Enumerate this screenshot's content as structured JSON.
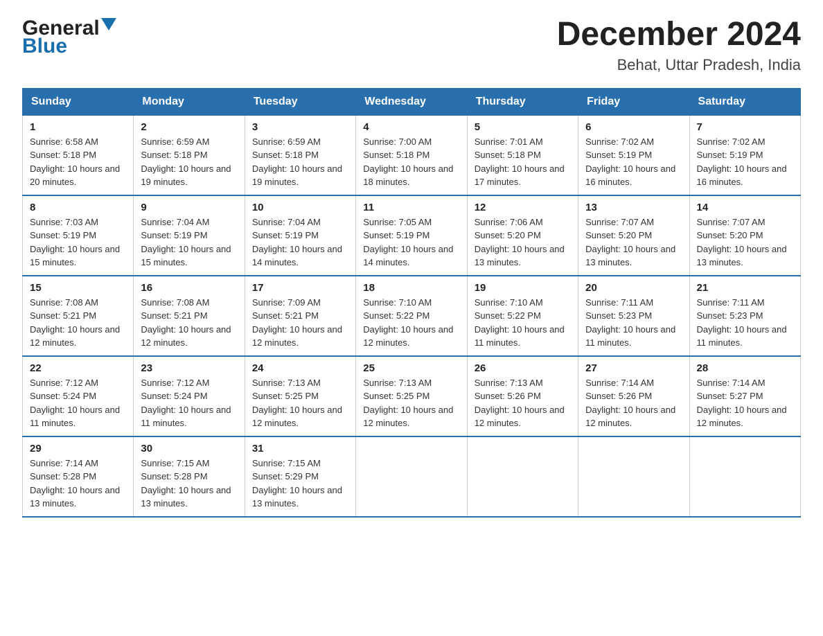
{
  "logo": {
    "general": "General",
    "blue": "Blue"
  },
  "title": "December 2024",
  "subtitle": "Behat, Uttar Pradesh, India",
  "days_of_week": [
    "Sunday",
    "Monday",
    "Tuesday",
    "Wednesday",
    "Thursday",
    "Friday",
    "Saturday"
  ],
  "weeks": [
    [
      {
        "num": "1",
        "sunrise": "6:58 AM",
        "sunset": "5:18 PM",
        "daylight": "10 hours and 20 minutes."
      },
      {
        "num": "2",
        "sunrise": "6:59 AM",
        "sunset": "5:18 PM",
        "daylight": "10 hours and 19 minutes."
      },
      {
        "num": "3",
        "sunrise": "6:59 AM",
        "sunset": "5:18 PM",
        "daylight": "10 hours and 19 minutes."
      },
      {
        "num": "4",
        "sunrise": "7:00 AM",
        "sunset": "5:18 PM",
        "daylight": "10 hours and 18 minutes."
      },
      {
        "num": "5",
        "sunrise": "7:01 AM",
        "sunset": "5:18 PM",
        "daylight": "10 hours and 17 minutes."
      },
      {
        "num": "6",
        "sunrise": "7:02 AM",
        "sunset": "5:19 PM",
        "daylight": "10 hours and 16 minutes."
      },
      {
        "num": "7",
        "sunrise": "7:02 AM",
        "sunset": "5:19 PM",
        "daylight": "10 hours and 16 minutes."
      }
    ],
    [
      {
        "num": "8",
        "sunrise": "7:03 AM",
        "sunset": "5:19 PM",
        "daylight": "10 hours and 15 minutes."
      },
      {
        "num": "9",
        "sunrise": "7:04 AM",
        "sunset": "5:19 PM",
        "daylight": "10 hours and 15 minutes."
      },
      {
        "num": "10",
        "sunrise": "7:04 AM",
        "sunset": "5:19 PM",
        "daylight": "10 hours and 14 minutes."
      },
      {
        "num": "11",
        "sunrise": "7:05 AM",
        "sunset": "5:19 PM",
        "daylight": "10 hours and 14 minutes."
      },
      {
        "num": "12",
        "sunrise": "7:06 AM",
        "sunset": "5:20 PM",
        "daylight": "10 hours and 13 minutes."
      },
      {
        "num": "13",
        "sunrise": "7:07 AM",
        "sunset": "5:20 PM",
        "daylight": "10 hours and 13 minutes."
      },
      {
        "num": "14",
        "sunrise": "7:07 AM",
        "sunset": "5:20 PM",
        "daylight": "10 hours and 13 minutes."
      }
    ],
    [
      {
        "num": "15",
        "sunrise": "7:08 AM",
        "sunset": "5:21 PM",
        "daylight": "10 hours and 12 minutes."
      },
      {
        "num": "16",
        "sunrise": "7:08 AM",
        "sunset": "5:21 PM",
        "daylight": "10 hours and 12 minutes."
      },
      {
        "num": "17",
        "sunrise": "7:09 AM",
        "sunset": "5:21 PM",
        "daylight": "10 hours and 12 minutes."
      },
      {
        "num": "18",
        "sunrise": "7:10 AM",
        "sunset": "5:22 PM",
        "daylight": "10 hours and 12 minutes."
      },
      {
        "num": "19",
        "sunrise": "7:10 AM",
        "sunset": "5:22 PM",
        "daylight": "10 hours and 11 minutes."
      },
      {
        "num": "20",
        "sunrise": "7:11 AM",
        "sunset": "5:23 PM",
        "daylight": "10 hours and 11 minutes."
      },
      {
        "num": "21",
        "sunrise": "7:11 AM",
        "sunset": "5:23 PM",
        "daylight": "10 hours and 11 minutes."
      }
    ],
    [
      {
        "num": "22",
        "sunrise": "7:12 AM",
        "sunset": "5:24 PM",
        "daylight": "10 hours and 11 minutes."
      },
      {
        "num": "23",
        "sunrise": "7:12 AM",
        "sunset": "5:24 PM",
        "daylight": "10 hours and 11 minutes."
      },
      {
        "num": "24",
        "sunrise": "7:13 AM",
        "sunset": "5:25 PM",
        "daylight": "10 hours and 12 minutes."
      },
      {
        "num": "25",
        "sunrise": "7:13 AM",
        "sunset": "5:25 PM",
        "daylight": "10 hours and 12 minutes."
      },
      {
        "num": "26",
        "sunrise": "7:13 AM",
        "sunset": "5:26 PM",
        "daylight": "10 hours and 12 minutes."
      },
      {
        "num": "27",
        "sunrise": "7:14 AM",
        "sunset": "5:26 PM",
        "daylight": "10 hours and 12 minutes."
      },
      {
        "num": "28",
        "sunrise": "7:14 AM",
        "sunset": "5:27 PM",
        "daylight": "10 hours and 12 minutes."
      }
    ],
    [
      {
        "num": "29",
        "sunrise": "7:14 AM",
        "sunset": "5:28 PM",
        "daylight": "10 hours and 13 minutes."
      },
      {
        "num": "30",
        "sunrise": "7:15 AM",
        "sunset": "5:28 PM",
        "daylight": "10 hours and 13 minutes."
      },
      {
        "num": "31",
        "sunrise": "7:15 AM",
        "sunset": "5:29 PM",
        "daylight": "10 hours and 13 minutes."
      },
      null,
      null,
      null,
      null
    ]
  ]
}
